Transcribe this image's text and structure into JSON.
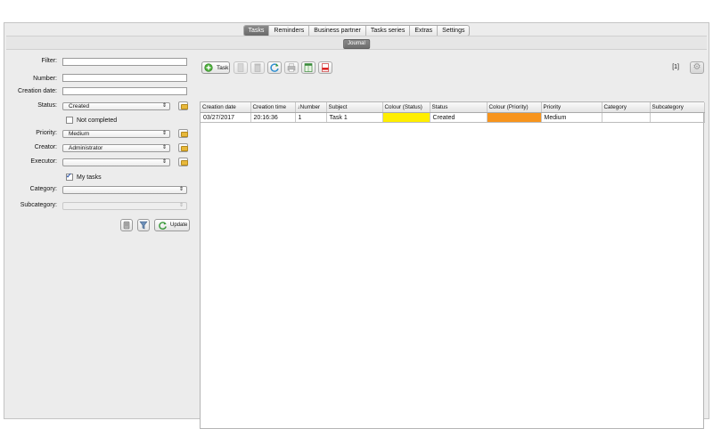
{
  "tabs": [
    {
      "label": "Tasks",
      "active": true
    },
    {
      "label": "Reminders",
      "active": false
    },
    {
      "label": "Business partner",
      "active": false
    },
    {
      "label": "Tasks series",
      "active": false
    },
    {
      "label": "Extras",
      "active": false
    },
    {
      "label": "Settings",
      "active": false
    }
  ],
  "subtab": "Journal",
  "filters": {
    "filter_label": "Filter:",
    "filter_value": "",
    "number_label": "Number:",
    "number_value": "",
    "creation_date_label": "Creation date:",
    "creation_date_value": "",
    "status_label": "Status:",
    "status_value": "Created",
    "not_completed_label": "Not completed",
    "not_completed_checked": false,
    "priority_label": "Priority:",
    "priority_value": "Medium",
    "creator_label": "Creator:",
    "creator_value": "Administrator",
    "executor_label": "Executor:",
    "executor_value": "",
    "my_tasks_label": "My tasks",
    "my_tasks_checked": true,
    "category_label": "Category:",
    "category_value": "",
    "subcategory_label": "Subcategory:",
    "subcategory_value": "",
    "update_label": "Update"
  },
  "toolbar": {
    "task_label": "Task",
    "page_count": "[1]"
  },
  "icons": {
    "task": "plus-circle-icon",
    "delete": "trash-icon",
    "copy": "document-icon",
    "archive": "clipboard-icon",
    "refresh": "refresh-icon",
    "print": "printer-icon",
    "excel": "spreadsheet-icon",
    "pdf": "pdf-icon",
    "settings": "gear-icon",
    "folder": "folder-icon",
    "filter": "funnel-icon",
    "clear": "eraser-icon"
  },
  "table": {
    "columns": [
      "Creation date",
      "Creation time",
      "↓Number",
      "Subject",
      "Colour (Status)",
      "Status",
      "Colour (Priority)",
      "Priority",
      "Category",
      "Subcategory"
    ],
    "rows": [
      {
        "creation_date": "03/27/2017",
        "creation_time": "20:16:36",
        "number": "1",
        "subject": "Task 1",
        "status_color": "#ffee00",
        "status": "Created",
        "priority_color": "#f7941d",
        "priority": "Medium",
        "category": "",
        "subcategory": ""
      }
    ]
  },
  "colors": {
    "active_tab": "#787878",
    "window_bg": "#ececec",
    "status_yellow": "#ffee00",
    "priority_orange": "#f7941d"
  }
}
